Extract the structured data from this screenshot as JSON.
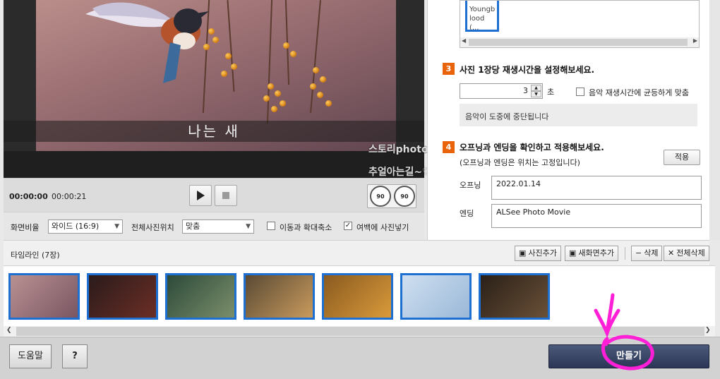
{
  "preview": {
    "caption": "나는 새",
    "watermark_line1": "스토리photo",
    "watermark_line2": "추얼아는길~♡"
  },
  "player": {
    "current_time": "00:00:00",
    "total_time": "00:00:21",
    "rotate_left_label": "90",
    "rotate_right_label": "90"
  },
  "settings": {
    "aspect_label": "화면비율",
    "aspect_value": "와이드 (16:9)",
    "position_label": "전체사진위치",
    "position_value": "맞춤",
    "zoom_label": "이동과 확대축소",
    "zoom_checked": false,
    "fill_label": "여백에 사진넣기",
    "fill_checked": true
  },
  "music": {
    "selected_item": "Youngblood (...",
    "selected_item_line1": "Youngb",
    "selected_item_line2": "lood (..."
  },
  "step3": {
    "number": "3",
    "title": "사진 1장당 재생시간을 설정해보세요.",
    "seconds_value": "3",
    "seconds_unit": "초",
    "even_label": "음악 재생시간에 균등하게 맞춤",
    "even_checked": false,
    "notice": "음악이 도중에 중단됩니다"
  },
  "step4": {
    "number": "4",
    "title": "오프닝과 엔딩을 확인하고 적용해보세요.",
    "subtitle": "(오프닝과 엔딩은 위치는 고정입니다)",
    "apply_label": "적용",
    "opening_label": "오프닝",
    "opening_value": "2022.01.14",
    "ending_label": "엔딩",
    "ending_value": "ALSee Photo Movie"
  },
  "timeline": {
    "title": "타임라인 (7장)",
    "add_photo": "사진추가",
    "add_screen": "새화면추가",
    "delete": "삭제",
    "delete_all": "전체삭제",
    "thumbnails": [
      {
        "name": "bird",
        "color_a": "#b89192",
        "color_b": "#7a5662"
      },
      {
        "name": "cat",
        "color_a": "#2a1b1b",
        "color_b": "#6b2e25"
      },
      {
        "name": "elephant-forest",
        "color_a": "#2d4a3a",
        "color_b": "#7a8e6a"
      },
      {
        "name": "elephant-sunset",
        "color_a": "#5a4a35",
        "color_b": "#c99a5c"
      },
      {
        "name": "fox",
        "color_a": "#8a5a20",
        "color_b": "#d99a3a"
      },
      {
        "name": "arctic-fox",
        "color_a": "#cfdff0",
        "color_b": "#9ab8d8"
      },
      {
        "name": "owl",
        "color_a": "#2a2018",
        "color_b": "#6a5038"
      }
    ]
  },
  "bottom": {
    "help_label": "도움말",
    "question_label": "?",
    "make_label": "만들기"
  },
  "colors": {
    "accent_orange": "#e8630a",
    "selection_blue": "#1d6fd1",
    "annotation_magenta": "#ff1fd6",
    "make_button": "#2c3656"
  }
}
